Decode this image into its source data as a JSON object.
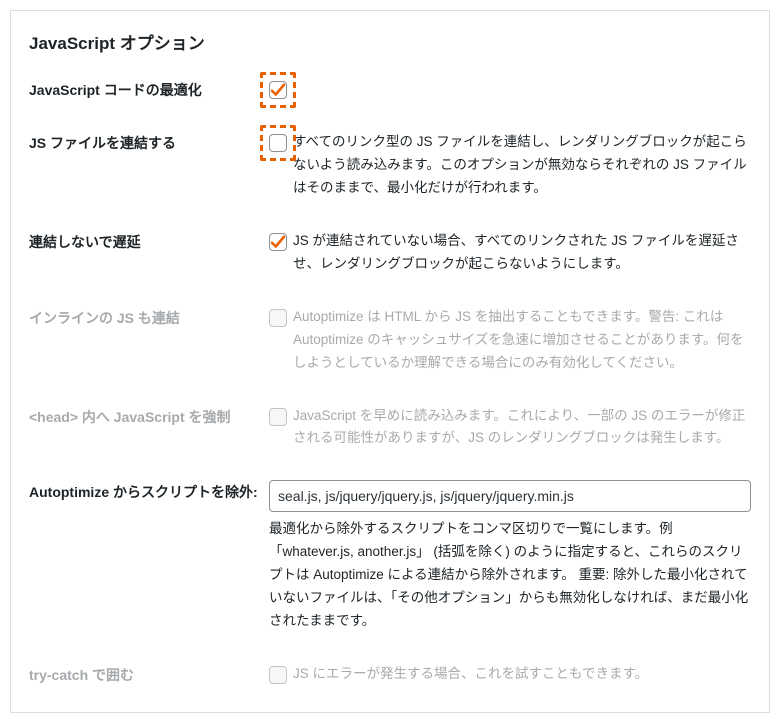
{
  "section_title": "JavaScript オプション",
  "rows": {
    "optimize": {
      "label": "JavaScript コードの最適化",
      "checked": true,
      "highlight": true,
      "desc": ""
    },
    "aggregate": {
      "label": "JS ファイルを連結する",
      "checked": false,
      "highlight": true,
      "desc": "すべてのリンク型の JS ファイルを連結し、レンダリングブロックが起こらないよう読み込みます。このオプションが無効ならそれぞれの JS ファイルはそのままで、最小化だけが行われます。"
    },
    "defer": {
      "label": "連結しないで遅延",
      "checked": true,
      "highlight": false,
      "desc": "JS が連結されていない場合、すべてのリンクされた JS ファイルを遅延させ、レンダリングブロックが起こらないようにします。"
    },
    "inline": {
      "label": "インラインの JS も連結",
      "checked": false,
      "desc": "Autoptimize は HTML から JS を抽出することもできます。警告: これは Autoptimize のキャッシュサイズを急速に増加させることがあります。何をしようとしているか理解できる場合にのみ有効化してください。"
    },
    "forcehead": {
      "label": "<head> 内へ JavaScript を強制",
      "checked": false,
      "desc": "JavaScript を早めに読み込みます。これにより、一部の JS のエラーが修正される可能性がありますが、JS のレンダリングブロックは発生します。"
    },
    "exclude": {
      "label": "Autoptimize からスクリプトを除外:",
      "value": "seal.js, js/jquery/jquery.js, js/jquery/jquery.min.js",
      "desc": "最適化から除外するスクリプトをコンマ区切りで一覧にします。例「whatever.js, another.js」 (括弧を除く) のように指定すると、これらのスクリプトは Autoptimize による連結から除外されます。  重要: 除外した最小化されていないファイルは、「その他オプション」からも無効化しなければ、まだ最小化されたままです。"
    },
    "trycatch": {
      "label": "try-catch で囲む",
      "checked": false,
      "desc": "JS にエラーが発生する場合、これを試すこともできます。"
    }
  }
}
